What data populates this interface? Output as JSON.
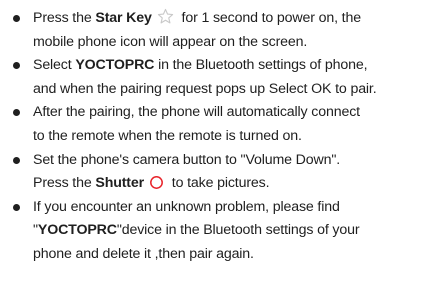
{
  "items": [
    {
      "l1_pre": "Press the ",
      "l1_bold": "Star Key",
      "l1_post": " for 1 second to power on, the",
      "l2": "mobile phone icon will appear on the screen."
    },
    {
      "l1_pre": "Select ",
      "l1_bold": "YOCTOPRC",
      "l1_post": " in the Bluetooth settings of phone,",
      "l2": "and when the pairing request pops up Select OK to pair."
    },
    {
      "l1": "After the pairing, the phone will automatically connect",
      "l2": "to the remote when the remote is turned on."
    },
    {
      "l1": "Set the phone's camera button to \"Volume Down\".",
      "l2_pre": "Press the ",
      "l2_bold": "Shutter",
      "l2_post": " to take pictures."
    },
    {
      "l1": "If you encounter an unknown problem, please find",
      "l2_pre": "\"",
      "l2_bold": "YOCTOPRC",
      "l2_post": "\"device in the Bluetooth settings of your",
      "l3": "phone and  delete it ,then pair again."
    }
  ],
  "icons": {
    "star": "star-outline-icon",
    "shutter": "shutter-circle-icon",
    "star_color": "#c9c9c9",
    "shutter_color": "#e8232a",
    "text_color": "#1f1f1f"
  }
}
